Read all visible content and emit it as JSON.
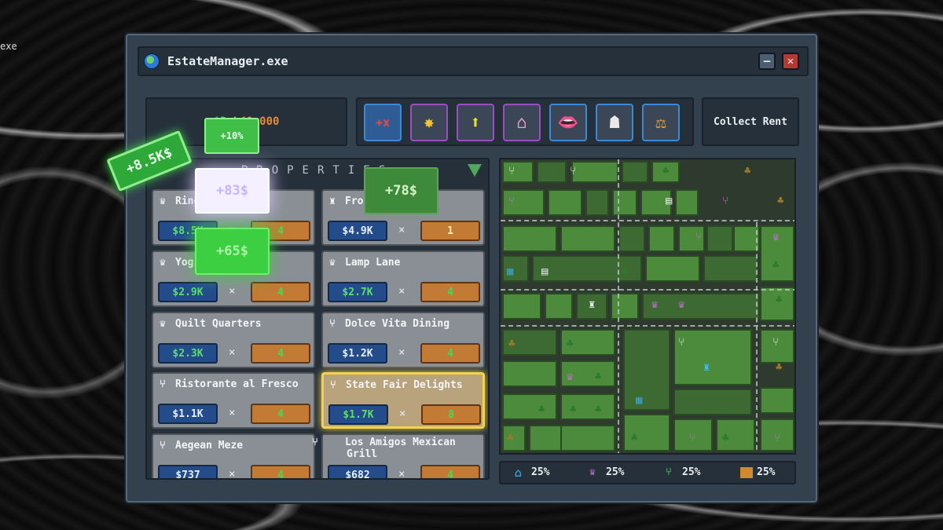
{
  "background": {
    "corner_label": "exe"
  },
  "window": {
    "title": "EstateManager.exe",
    "min_label": "–",
    "close_label": "✕"
  },
  "money": {
    "current": "$2",
    "separator": "/",
    "goal": "40,000"
  },
  "toolbar": {
    "tools": [
      {
        "name": "multiplier",
        "glyph": "+x",
        "border": "#3b8ad8"
      },
      {
        "name": "sparkle",
        "glyph": "✸",
        "border": "#9a4fc0"
      },
      {
        "name": "upgrade",
        "glyph": "⬆",
        "border": "#9a4fc0"
      },
      {
        "name": "house-swap",
        "glyph": "⌂",
        "border": "#9a4fc0"
      },
      {
        "name": "mouth",
        "glyph": "👄",
        "border": "#3b8ad8"
      },
      {
        "name": "hire",
        "glyph": "☗",
        "border": "#3b8ad8"
      },
      {
        "name": "balance",
        "glyph": "⚖",
        "border": "#3b8ad8"
      }
    ],
    "collect_label": "Collect Rent"
  },
  "properties": {
    "header": "PROPERTIES",
    "cards": [
      {
        "name": "Ring",
        "icon": "cupcake",
        "price": "$8.5K",
        "times": "×",
        "qty": "4",
        "price_green": true,
        "qty_green": true
      },
      {
        "name": "Fro",
        "icon": "rook",
        "price": "$4.9K",
        "times": "×",
        "qty": "1"
      },
      {
        "name": "Yog",
        "icon": "cupcake",
        "price": "$2.9K",
        "times": "×",
        "qty": "4",
        "price_green": true,
        "qty_green": true
      },
      {
        "name": "Lamp Lane",
        "icon": "cupcake",
        "price": "$2.7K",
        "times": "×",
        "qty": "4",
        "price_green": true,
        "qty_green": true
      },
      {
        "name": "Quilt Quarters",
        "icon": "cupcake",
        "price": "$2.3K",
        "times": "×",
        "qty": "4",
        "price_green": true,
        "qty_green": true
      },
      {
        "name": "Dolce Vita Dining",
        "icon": "fork",
        "price": "$1.2K",
        "times": "×",
        "qty": "4",
        "qty_green": true
      },
      {
        "name": "Ristorante al Fresco",
        "icon": "fork",
        "price": "$1.1K",
        "times": "×",
        "qty": "4",
        "qty_green": true
      },
      {
        "name": "State Fair Delights",
        "icon": "fork",
        "price": "$1.7K",
        "times": "×",
        "qty": "8",
        "price_green": true,
        "qty_green": true,
        "active": true
      },
      {
        "name": "Aegean Meze",
        "icon": "fork",
        "price": "$737",
        "times": "×",
        "qty": "4",
        "qty_green": true
      },
      {
        "name": "Los Amigos Mexican Grill",
        "icon": "fork",
        "price": "$682",
        "times": "×",
        "qty": "4",
        "qty_green": true
      }
    ]
  },
  "popups": [
    {
      "text": "+8.5K$",
      "kind": "green-tilted"
    },
    {
      "text": "+10%",
      "kind": "green-small"
    },
    {
      "text": "+83$",
      "kind": "white-glow"
    },
    {
      "text": "+78$",
      "kind": "green-dim"
    },
    {
      "text": "+65$",
      "kind": "green-glow"
    }
  ],
  "stats": [
    {
      "icon": "house-icon",
      "value": "25%",
      "color": "#3aa0d8"
    },
    {
      "icon": "cupcake-icon",
      "value": "25%",
      "color": "#b66bc9"
    },
    {
      "icon": "fork-icon",
      "value": "25%",
      "color": "#3fae4a"
    },
    {
      "icon": "factory-icon",
      "value": "25%",
      "color": "#d0892f"
    }
  ]
}
